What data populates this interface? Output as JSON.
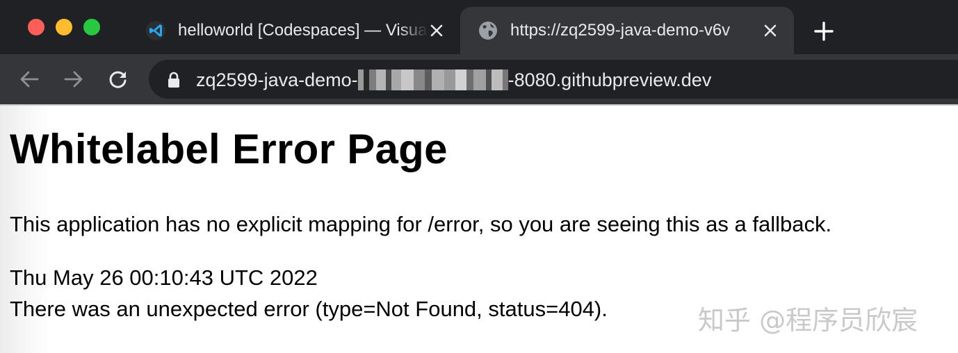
{
  "browser": {
    "tabs": [
      {
        "title": "helloworld [Codespaces] — Visual Studio Code",
        "icon": "vscode-icon",
        "active": false
      },
      {
        "title": "https://zq2599-java-demo-v6v",
        "icon": "globe-icon",
        "active": true
      }
    ],
    "address_bar": {
      "url_prefix": "zq2599-java-demo-",
      "url_suffix": "-8080.githubpreview.dev",
      "secure": true
    }
  },
  "page": {
    "title": "Whitelabel Error Page",
    "description": "This application has no explicit mapping for /error, so you are seeing this as a fallback.",
    "timestamp": "Thu May 26 00:10:43 UTC 2022",
    "error_line": "There was an unexpected error (type=Not Found, status=404)."
  },
  "watermark": "知乎 @程序员欣宸",
  "colors": {
    "tabstrip": "#202124",
    "toolbar": "#35363a",
    "omnibox": "#202124",
    "traffic_red": "#ff5f57",
    "traffic_yellow": "#febc2e",
    "traffic_green": "#28c840",
    "vscode_blue": "#23a9f2"
  }
}
